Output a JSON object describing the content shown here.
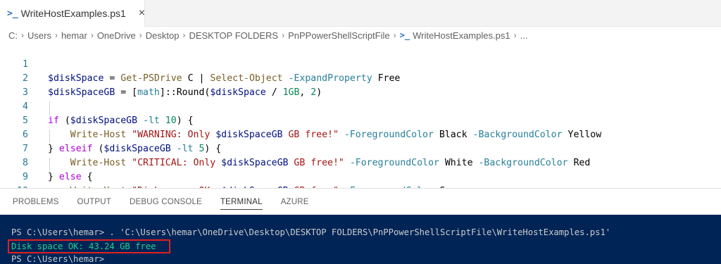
{
  "tab": {
    "icon": "powershell-icon",
    "label": "WriteHostExamples.ps1",
    "close": "×"
  },
  "breadcrumb": [
    "C:",
    "Users",
    "hemar",
    "OneDrive",
    "Desktop",
    "DESKTOP FOLDERS",
    "PnPPowerShellScriptFile",
    "WriteHostExamples.ps1",
    "..."
  ],
  "editor": {
    "line_numbers": [
      "1",
      "2",
      "3",
      "4",
      "5",
      "6",
      "7",
      "8",
      "9",
      "10"
    ]
  },
  "panel": {
    "tabs": [
      "PROBLEMS",
      "OUTPUT",
      "DEBUG CONSOLE",
      "TERMINAL",
      "AZURE"
    ],
    "active_tab": "TERMINAL"
  },
  "terminal": {
    "line1": "PS C:\\Users\\hemar> . 'C:\\Users\\hemar\\OneDrive\\Desktop\\DESKTOP FOLDERS\\PnPPowerShellScriptFile\\WriteHostExamples.ps1'",
    "line2": "Disk space OK: 43.24 GB free",
    "line3": "PS C:\\Users\\hemar>"
  },
  "colors": {
    "terminal_bg": "#012456",
    "terminal_ok": "#23d18b",
    "highlight_box": "#e02020"
  }
}
